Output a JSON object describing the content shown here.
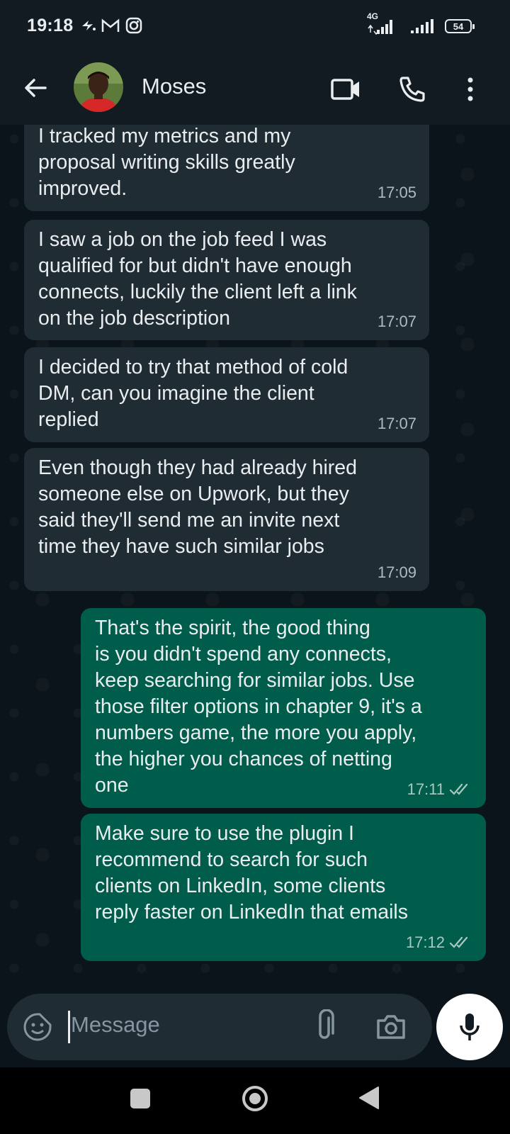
{
  "status_bar": {
    "time": "19:18",
    "network_label": "4G",
    "battery": "54"
  },
  "header": {
    "contact_name": "Moses",
    "icons": [
      "back-arrow-icon",
      "avatar",
      "video-call-icon",
      "phone-icon",
      "more-vert-icon"
    ]
  },
  "messages": [
    {
      "direction": "in",
      "text": "I tracked my metrics and my\nproposal writing skills greatly\nimproved.",
      "time": "17:05"
    },
    {
      "direction": "in",
      "text": "I saw a job on the job feed I was\nqualified for but didn't have enough\nconnects, luckily the client left a link\non the job description",
      "time": "17:07"
    },
    {
      "direction": "in",
      "text": "I decided to try that method of cold\nDM, can you imagine the client\nreplied",
      "time": "17:07"
    },
    {
      "direction": "in",
      "text": "Even though they had already hired\nsomeone else on Upwork, but they\nsaid they'll send me an invite next\ntime they have such similar jobs",
      "time": "17:09"
    },
    {
      "direction": "out",
      "text": "That's the spirit, the good thing\nis you didn't spend any connects,\nkeep searching for similar jobs. Use\nthose filter options in chapter 9, it's a\nnumbers game, the more you apply,\nthe higher you chances of netting\none",
      "time": "17:11",
      "status": "read"
    },
    {
      "direction": "out",
      "text": "Make sure to use the plugin I\nrecommend to search for such\nclients on LinkedIn, some clients\nreply faster on LinkedIn that emails",
      "time": "17:12",
      "status": "read"
    }
  ],
  "input": {
    "placeholder": "Message"
  },
  "colors": {
    "background": "#0b141a",
    "header": "#111b21",
    "incoming_bubble": "#202c33",
    "outgoing_bubble": "#005c4b",
    "input_bar": "#1f2c34"
  }
}
